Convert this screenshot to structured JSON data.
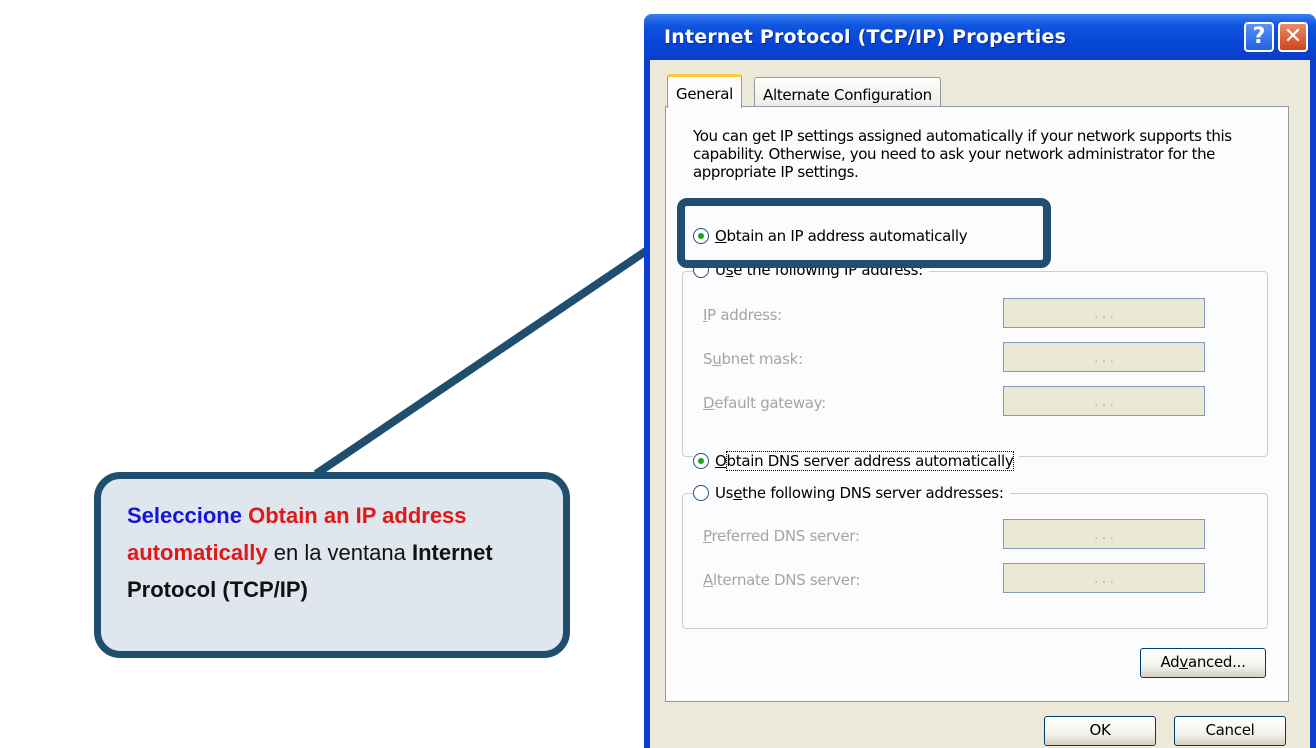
{
  "callout": {
    "select_word": "Seleccione",
    "option_part1": "Obtain an IP address",
    "option_part2": "automatically",
    "mid_text": "en la ventana",
    "window_part1": "Internet",
    "window_part2": "Protocol (TCP/IP)"
  },
  "dialog": {
    "title": "Internet Protocol (TCP/IP) Properties",
    "help_label": "?",
    "close_label": "✕",
    "tabs": [
      {
        "label": "General",
        "active": true
      },
      {
        "label": "Alternate Configuration",
        "active": false
      }
    ],
    "description": "You can get IP settings assigned automatically if your network supports this capability. Otherwise, you need to ask your network administrator for the appropriate IP settings.",
    "ip_auto": {
      "before": "",
      "key": "O",
      "after": "btain an IP address automatically",
      "checked": true
    },
    "ip_manual": {
      "before": "U",
      "key": "s",
      "after": "e the following IP address:",
      "checked": false
    },
    "ip_fields": [
      {
        "before": "",
        "key": "I",
        "after": "P address:",
        "dots": ". . ."
      },
      {
        "before": "S",
        "key": "u",
        "after": "bnet mask:",
        "dots": ". . ."
      },
      {
        "before": "",
        "key": "D",
        "after": "efault gateway:",
        "dots": ". . ."
      }
    ],
    "dns_auto": {
      "before": "",
      "key": "O",
      "after": "btain DNS server address automatically",
      "checked": true
    },
    "dns_manual": {
      "before": "Us",
      "key": "e",
      "after": " the following DNS server addresses:",
      "checked": false
    },
    "dns_fields": [
      {
        "before": "",
        "key": "P",
        "after": "referred DNS server:",
        "dots": ". . ."
      },
      {
        "before": "",
        "key": "A",
        "after": "lternate DNS server:",
        "dots": ". . ."
      }
    ],
    "advanced": {
      "before": "Ad",
      "key": "v",
      "after": "anced..."
    },
    "ok_label": "OK",
    "cancel_label": "Cancel"
  },
  "colors": {
    "accent_frame": "#1f4e6e",
    "callout_bg": "#dfe6ee",
    "blue_text": "#1515e0",
    "red_text": "#e01818",
    "titlebar": "#0a3fd0"
  }
}
